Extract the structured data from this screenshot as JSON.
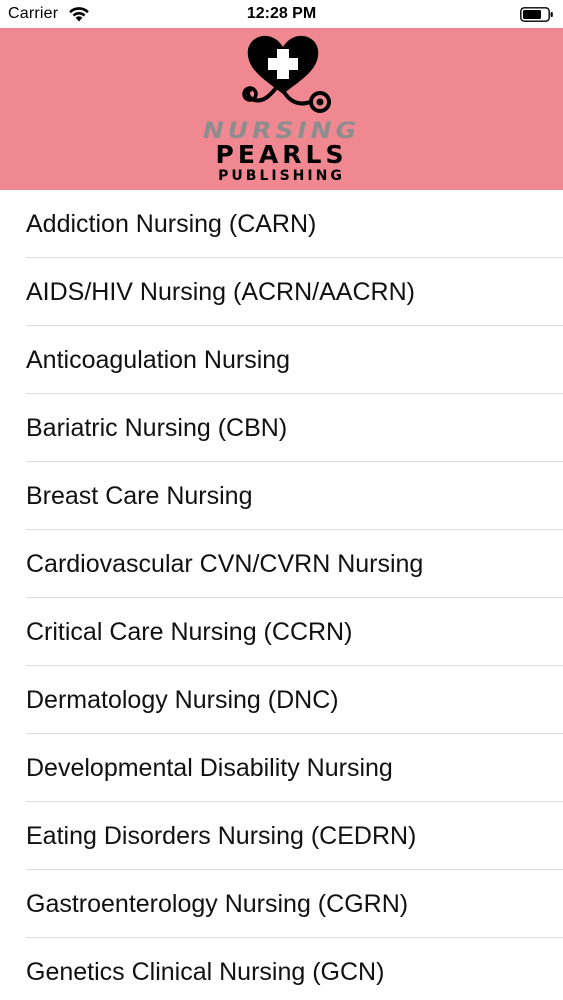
{
  "status_bar": {
    "carrier": "Carrier",
    "time": "12:28 PM",
    "wifi_icon": "wifi-icon",
    "battery_icon": "battery-icon"
  },
  "header": {
    "background_color": "#ef8890",
    "logo_icon": "heart-stethoscope-icon",
    "logo_line_1": "NURSING",
    "logo_line_2": "PEARLS",
    "logo_line_3": "PUBLISHING"
  },
  "list": {
    "items": [
      {
        "label": "Addiction Nursing (CARN)"
      },
      {
        "label": "AIDS/HIV Nursing (ACRN/AACRN)"
      },
      {
        "label": "Anticoagulation Nursing"
      },
      {
        "label": "Bariatric Nursing (CBN)"
      },
      {
        "label": "Breast Care Nursing"
      },
      {
        "label": "Cardiovascular CVN/CVRN Nursing"
      },
      {
        "label": "Critical Care Nursing (CCRN)"
      },
      {
        "label": "Dermatology Nursing (DNC)"
      },
      {
        "label": "Developmental Disability Nursing"
      },
      {
        "label": "Eating Disorders Nursing (CEDRN)"
      },
      {
        "label": "Gastroenterology Nursing (CGRN)"
      },
      {
        "label": "Genetics Clinical Nursing (GCN)"
      }
    ]
  }
}
